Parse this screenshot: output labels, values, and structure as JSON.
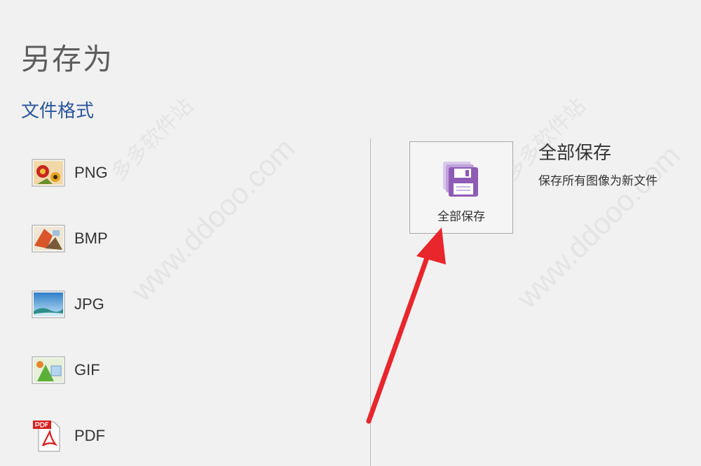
{
  "page": {
    "title": "另存为"
  },
  "section": {
    "title": "文件格式"
  },
  "formats": [
    {
      "label": "PNG",
      "icon": "png-image-icon"
    },
    {
      "label": "BMP",
      "icon": "bmp-image-icon"
    },
    {
      "label": "JPG",
      "icon": "jpg-image-icon"
    },
    {
      "label": "GIF",
      "icon": "gif-image-icon"
    },
    {
      "label": "PDF",
      "icon": "pdf-file-icon"
    }
  ],
  "save_all": {
    "tile_label": "全部保存",
    "title": "全部保存",
    "description": "保存所有图像为新文件",
    "icon": "save-all-floppy-icon"
  },
  "watermark": {
    "text": "www.ddooo.com",
    "site_name": "多多软件站"
  },
  "colors": {
    "section_title": "#2b579a",
    "save_icon": "#8e5bb5",
    "arrow": "#e8262c"
  }
}
